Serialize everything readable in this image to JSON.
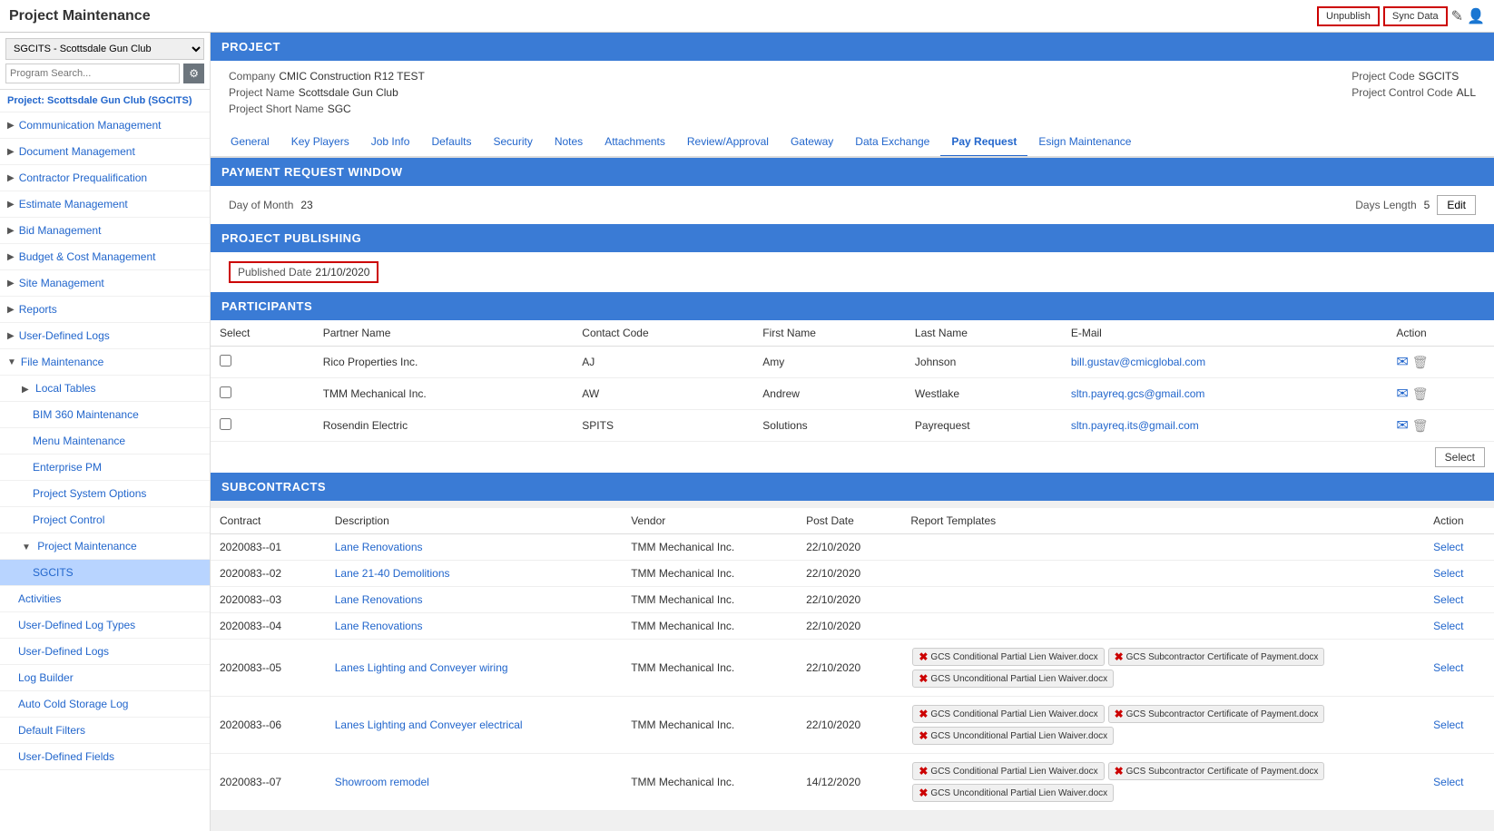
{
  "header": {
    "title": "Project Maintenance",
    "btn_unpublish": "Unpublish",
    "btn_sync": "Sync Data"
  },
  "sidebar": {
    "selected_project": "SGCITS - Scottsdale Gun Club",
    "search_placeholder": "Program Search...",
    "project_link": "Project: Scottsdale Gun Club (SGCITS)",
    "sections": [
      {
        "id": "communication",
        "label": "Communication Management",
        "expanded": false
      },
      {
        "id": "document",
        "label": "Document Management",
        "expanded": false
      },
      {
        "id": "contractor",
        "label": "Contractor Prequalification",
        "expanded": false
      },
      {
        "id": "estimate",
        "label": "Estimate Management",
        "expanded": false
      },
      {
        "id": "bid",
        "label": "Bid Management",
        "expanded": false
      },
      {
        "id": "budget",
        "label": "Budget & Cost Management",
        "expanded": false
      },
      {
        "id": "site",
        "label": "Site Management",
        "expanded": false
      },
      {
        "id": "reports",
        "label": "Reports",
        "expanded": false
      },
      {
        "id": "userlogs",
        "label": "User-Defined Logs",
        "expanded": false
      },
      {
        "id": "filemaint",
        "label": "File Maintenance",
        "expanded": true
      }
    ],
    "file_maintenance_items": [
      {
        "id": "local_tables",
        "label": "Local Tables",
        "expanded": true,
        "level": 1
      },
      {
        "id": "bim360",
        "label": "BIM 360 Maintenance",
        "level": 2
      },
      {
        "id": "menu",
        "label": "Menu Maintenance",
        "level": 2
      },
      {
        "id": "enterprise_pm",
        "label": "Enterprise PM",
        "level": 2
      },
      {
        "id": "project_system_options",
        "label": "Project System Options",
        "level": 2
      },
      {
        "id": "project_control",
        "label": "Project Control",
        "level": 2
      },
      {
        "id": "project_maintenance",
        "label": "Project Maintenance",
        "level": 2,
        "expanded": true
      },
      {
        "id": "sgcits",
        "label": "SGCITS",
        "level": 3,
        "active": true
      }
    ],
    "extra_items": [
      {
        "id": "activities",
        "label": "Activities"
      },
      {
        "id": "user_defined_log_types",
        "label": "User-Defined Log Types"
      },
      {
        "id": "user_defined_logs2",
        "label": "User-Defined Logs"
      },
      {
        "id": "log_builder",
        "label": "Log Builder"
      },
      {
        "id": "auto_cold_storage",
        "label": "Auto Cold Storage Log"
      },
      {
        "id": "default_filters",
        "label": "Default Filters"
      },
      {
        "id": "user_defined_fields",
        "label": "User-Defined Fields"
      }
    ]
  },
  "project": {
    "company_label": "Company",
    "company_value": "CMIC Construction R12 TEST",
    "project_name_label": "Project Name",
    "project_name_value": "Scottsdale Gun Club",
    "project_short_name_label": "Project Short Name",
    "project_short_name_value": "SGC",
    "project_code_label": "Project Code",
    "project_code_value": "SGCITS",
    "project_control_code_label": "Project Control Code",
    "project_control_code_value": "ALL"
  },
  "tabs": [
    {
      "id": "general",
      "label": "General"
    },
    {
      "id": "key_players",
      "label": "Key Players"
    },
    {
      "id": "job_info",
      "label": "Job Info"
    },
    {
      "id": "defaults",
      "label": "Defaults"
    },
    {
      "id": "security",
      "label": "Security"
    },
    {
      "id": "notes",
      "label": "Notes"
    },
    {
      "id": "attachments",
      "label": "Attachments"
    },
    {
      "id": "review_approval",
      "label": "Review/Approval"
    },
    {
      "id": "gateway",
      "label": "Gateway"
    },
    {
      "id": "data_exchange",
      "label": "Data Exchange"
    },
    {
      "id": "pay_request",
      "label": "Pay Request",
      "active": true
    },
    {
      "id": "esign_maintenance",
      "label": "Esign Maintenance"
    }
  ],
  "payment_window": {
    "section_title": "PAYMENT REQUEST WINDOW",
    "day_of_month_label": "Day of Month",
    "day_of_month_value": "23",
    "days_length_label": "Days Length",
    "days_length_value": "5",
    "btn_edit": "Edit"
  },
  "project_publishing": {
    "section_title": "PROJECT PUBLISHING",
    "published_date_label": "Published Date",
    "published_date_value": "21/10/2020"
  },
  "participants": {
    "section_title": "PARTICIPANTS",
    "columns": [
      "Select",
      "Partner Name",
      "Contact Code",
      "First Name",
      "Last Name",
      "E-Mail",
      "Action"
    ],
    "rows": [
      {
        "partner_name": "Rico Properties Inc.",
        "contact_code": "AJ",
        "first_name": "Amy",
        "last_name": "Johnson",
        "email": "bill.gustav@cmicglobal.com"
      },
      {
        "partner_name": "TMM Mechanical Inc.",
        "contact_code": "AW",
        "first_name": "Andrew",
        "last_name": "Westlake",
        "email": "sltn.payreq.gcs@gmail.com"
      },
      {
        "partner_name": "Rosendin Electric",
        "contact_code": "SPITS",
        "first_name": "Solutions",
        "last_name": "Payrequest",
        "email": "sltn.payreq.its@gmail.com"
      }
    ],
    "btn_select": "Select"
  },
  "subcontracts": {
    "section_title": "SUBCONTRACTS",
    "columns": [
      "Contract",
      "Description",
      "Vendor",
      "Post Date",
      "Report Templates",
      "Action"
    ],
    "rows": [
      {
        "contract": "2020083--01",
        "description": "Lane Renovations",
        "vendor": "TMM Mechanical Inc.",
        "post_date": "22/10/2020",
        "report_templates": [],
        "action": "Select"
      },
      {
        "contract": "2020083--02",
        "description": "Lane 21-40 Demolitions",
        "vendor": "TMM Mechanical Inc.",
        "post_date": "22/10/2020",
        "report_templates": [],
        "action": "Select"
      },
      {
        "contract": "2020083--03",
        "description": "Lane Renovations",
        "vendor": "TMM Mechanical Inc.",
        "post_date": "22/10/2020",
        "report_templates": [],
        "action": "Select"
      },
      {
        "contract": "2020083--04",
        "description": "Lane Renovations",
        "vendor": "TMM Mechanical Inc.",
        "post_date": "22/10/2020",
        "report_templates": [],
        "action": "Select"
      },
      {
        "contract": "2020083--05",
        "description": "Lanes Lighting and Conveyer wiring",
        "vendor": "TMM Mechanical Inc.",
        "post_date": "22/10/2020",
        "report_templates": [
          "GCS Conditional Partial Lien Waiver.docx",
          "GCS Subcontractor Certificate of Payment.docx",
          "GCS Unconditional Partial Lien Waiver.docx"
        ],
        "action": "Select"
      },
      {
        "contract": "2020083--06",
        "description": "Lanes Lighting and Conveyer electrical",
        "vendor": "TMM Mechanical Inc.",
        "post_date": "22/10/2020",
        "report_templates": [
          "GCS Conditional Partial Lien Waiver.docx",
          "GCS Subcontractor Certificate of Payment.docx",
          "GCS Unconditional Partial Lien Waiver.docx"
        ],
        "action": "Select"
      },
      {
        "contract": "2020083--07",
        "description": "Showroom remodel",
        "vendor": "TMM Mechanical Inc.",
        "post_date": "14/12/2020",
        "report_templates": [
          "GCS Conditional Partial Lien Waiver.docx",
          "GCS Subcontractor Certificate of Payment.docx",
          "GCS Unconditional Partial Lien Waiver.docx"
        ],
        "action": "Select"
      }
    ]
  }
}
